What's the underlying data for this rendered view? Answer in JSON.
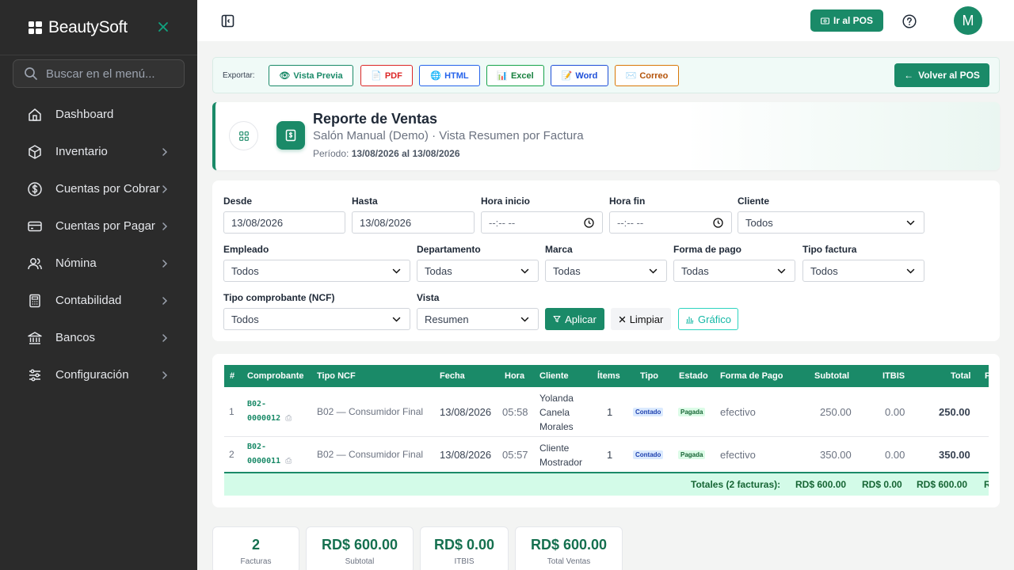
{
  "sidebar": {
    "brand": "BeautySoft",
    "search_placeholder": "Buscar en el menú...",
    "items": [
      {
        "label": "Dashboard"
      },
      {
        "label": "Inventario"
      },
      {
        "label": "Cuentas por Cobrar"
      },
      {
        "label": "Cuentas por Pagar"
      },
      {
        "label": "Nómina"
      },
      {
        "label": "Contabilidad"
      },
      {
        "label": "Bancos"
      },
      {
        "label": "Configuración"
      }
    ]
  },
  "topbar": {
    "pos_label": "Ir al POS",
    "avatar_initial": "M"
  },
  "export": {
    "label": "Exportar:",
    "buttons": {
      "preview": "Vista Previa",
      "pdf": "PDF",
      "html": "HTML",
      "excel": "Excel",
      "word": "Word",
      "email": "Correo"
    },
    "back_label": "Volver al POS"
  },
  "report": {
    "title": "Reporte de Ventas",
    "subtitle": "Salón Manual (Demo) · Vista Resumen por Factura",
    "period_label": "Período:",
    "period_value": "13/08/2026 al 13/08/2026"
  },
  "filters": {
    "desde": {
      "label": "Desde",
      "value": "13/08/2026"
    },
    "hasta": {
      "label": "Hasta",
      "value": "13/08/2026"
    },
    "hora_inicio": {
      "label": "Hora inicio",
      "value": "--:-- --"
    },
    "hora_fin": {
      "label": "Hora fin",
      "value": "--:-- --"
    },
    "cliente": {
      "label": "Cliente",
      "value": "Todos"
    },
    "empleado": {
      "label": "Empleado",
      "value": "Todos"
    },
    "departamento": {
      "label": "Departamento",
      "value": "Todas"
    },
    "marca": {
      "label": "Marca",
      "value": "Todas"
    },
    "forma_pago": {
      "label": "Forma de pago",
      "value": "Todas"
    },
    "tipo_factura": {
      "label": "Tipo factura",
      "value": "Todos"
    },
    "tipo_ncf": {
      "label": "Tipo comprobante (NCF)",
      "value": "Todos"
    },
    "vista": {
      "label": "Vista",
      "value": "Resumen"
    },
    "apply_label": "Aplicar",
    "clear_label": "Limpiar",
    "chart_label": "Gráfico"
  },
  "table": {
    "headers": [
      "#",
      "Comprobante",
      "Tipo NCF",
      "Fecha",
      "Hora",
      "Cliente",
      "Ítems",
      "Tipo",
      "Estado",
      "Forma de Pago",
      "Subtotal",
      "ITBIS",
      "Total",
      "P"
    ],
    "rows": [
      {
        "num": "1",
        "comprobante_a": "B02-",
        "comprobante_b": "0000012",
        "tipo_ncf": "B02 — Consumidor Final",
        "fecha": "13/08/2026",
        "hora": "05:58",
        "cliente_1": "Yolanda",
        "cliente_2": "Canela",
        "cliente_3": "Morales",
        "items": "1",
        "tipo": "Contado",
        "estado": "Pagada",
        "forma_pago": "efectivo",
        "subtotal": "250.00",
        "itbis": "0.00",
        "total": "250.00"
      },
      {
        "num": "2",
        "comprobante_a": "B02-",
        "comprobante_b": "0000011",
        "tipo_ncf": "B02 — Consumidor Final",
        "fecha": "13/08/2026",
        "hora": "05:57",
        "cliente_1": "Cliente",
        "cliente_2": "Mostrador",
        "cliente_3": "",
        "items": "1",
        "tipo": "Contado",
        "estado": "Pagada",
        "forma_pago": "efectivo",
        "subtotal": "350.00",
        "itbis": "0.00",
        "total": "350.00"
      }
    ],
    "totals": {
      "label": "Totales (2 facturas):",
      "subtotal": "RD$ 600.00",
      "itbis": "RD$ 0.00",
      "total": "RD$ 600.00",
      "cut": "R"
    }
  },
  "summary": [
    {
      "value": "2",
      "label": "Facturas"
    },
    {
      "value": "RD$ 600.00",
      "label": "Subtotal"
    },
    {
      "value": "RD$ 0.00",
      "label": "ITBIS"
    },
    {
      "value": "RD$ 600.00",
      "label": "Total Ventas"
    }
  ],
  "colors": {
    "primary": "#1a8a68",
    "sidebar_bg": "#2b2b2b",
    "totals_bg": "#d3fbe8"
  }
}
